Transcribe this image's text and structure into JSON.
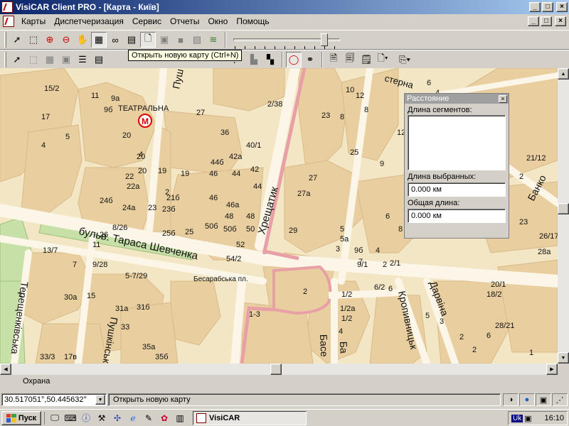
{
  "window": {
    "title": "VisiCAR Client PRO - [Карта - Київ]",
    "buttons": {
      "minimize": "_",
      "maximize": "□",
      "close": "×"
    }
  },
  "menu": {
    "items": [
      "Карты",
      "Диспетчеризация",
      "Сервис",
      "Отчеты",
      "Окно",
      "Помощь"
    ]
  },
  "toolbar1": {
    "icons": [
      "arrow-pointer-icon",
      "zoom-window-icon",
      "zoom-in-icon",
      "zoom-out-icon",
      "pan-hand-icon",
      "map-overview-icon",
      "binoculars-icon",
      "layer-icon",
      "open-map-icon",
      "print-icon",
      "rect-icon",
      "copy-icon",
      "layers-stack-icon"
    ],
    "zoom_slider_level": 0.88
  },
  "tooltip": "Открыть новую карту (Ctrl+N)",
  "map": {
    "labels": {
      "street_shevchenka": "бульв. Тараса Шевченка",
      "street_khreshchatyk": "Хрещатик",
      "metro_station": "ТЕАТРАЛЬНА",
      "metro_symbol": "М",
      "square": "Бесарабська пл.",
      "street_pushkinska": "Пуш",
      "street_kropyvnytskoho": "Кропивницьк",
      "street_darvina": "Дарвіна",
      "street_bankova": "Банко",
      "street_tereshchenkivska": "Терещенківська",
      "street_pushkinska_bottom": "Пушкінська",
      "street_basseina": "Басе",
      "street_basseina2": "Ба",
      "street_sterna": "стерна"
    },
    "house_numbers": [
      "15/2",
      "11",
      "9а",
      "9б",
      "17",
      "20",
      "4",
      "5",
      "20",
      "20",
      "22",
      "22а",
      "24б",
      "24а",
      "26",
      "8/26",
      "13/7",
      "11",
      "9/28",
      "7",
      "5-7/29",
      "1",
      "15",
      "30а",
      "31а",
      "31б",
      "33",
      "35а",
      "35б",
      "33/3",
      "17в",
      "19",
      "19",
      "21б",
      "23",
      "23б",
      "25б",
      "25",
      "27",
      "46",
      "44б",
      "44",
      "42а",
      "42",
      "40/1",
      "36",
      "44",
      "46",
      "46а",
      "48",
      "48",
      "50б",
      "50б",
      "50",
      "52",
      "54/2",
      "23",
      "8",
      "27",
      "27а",
      "29",
      "25",
      "9",
      "5",
      "5а",
      "3",
      "9б",
      "7",
      "9/1",
      "4",
      "6",
      "2",
      "2/1",
      "2/38",
      "12",
      "10",
      "8",
      "6",
      "4",
      "9",
      "8",
      "12",
      "2",
      "1/2",
      "1/2а",
      "1/2",
      "1-3",
      "4",
      "6/2",
      "6",
      "18/2",
      "20/1",
      "6",
      "2",
      "2",
      "21/12",
      "23",
      "26/17",
      "28а",
      "28/21",
      "2",
      "5",
      "3",
      "1",
      "2",
      "4",
      "2"
    ]
  },
  "distance_panel": {
    "title": "Расстояние",
    "segments_label": "Длина сегментов:",
    "selected_label": "Длина выбранных:",
    "selected_value": "0.000 км",
    "total_label": "Общая длина:",
    "total_value": "0.000 км"
  },
  "tab": {
    "label": "Охрана"
  },
  "status": {
    "coordinates": "30.517051°,50.445632°",
    "message": "Открыть новую карту"
  },
  "taskbar": {
    "start": "Пуск",
    "task": "VisiCAR",
    "lang": "Uk",
    "time": "16:10"
  }
}
